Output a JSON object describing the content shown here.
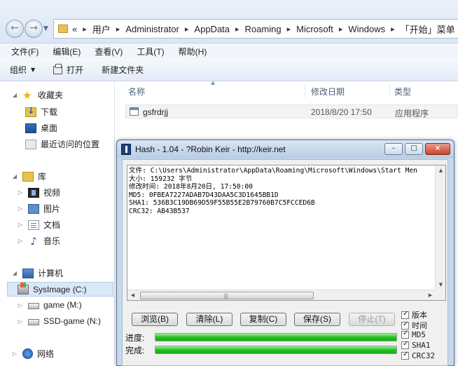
{
  "explorer": {
    "address": {
      "overflow_marker": "«",
      "crumbs": [
        "用户",
        "Administrator",
        "AppData",
        "Roaming",
        "Microsoft",
        "Windows",
        "「开始」菜单"
      ]
    },
    "menu": [
      "文件(F)",
      "编辑(E)",
      "查看(V)",
      "工具(T)",
      "帮助(H)"
    ],
    "toolbar": {
      "organize": "组织",
      "open": "打开",
      "new_folder": "新建文件夹"
    },
    "sidebar": {
      "favorites": "收藏夹",
      "downloads": "下载",
      "desktop": "桌面",
      "recent": "最近访问的位置",
      "libraries": "库",
      "videos": "视频",
      "pictures": "图片",
      "documents": "文档",
      "music": "音乐",
      "computer": "计算机",
      "drive_c": "SysImage (C:)",
      "drive_m": "game (M:)",
      "drive_n": "SSD-game (N:)",
      "network": "网络"
    },
    "columns": {
      "name": "名称",
      "date": "修改日期",
      "type": "类型"
    },
    "file": {
      "name": "gsfrdrjj",
      "date": "2018/8/20 17:50",
      "type": "应用程序"
    }
  },
  "hash_window": {
    "title": "Hash - 1.04 - ?Robin Keir - http://keir.net",
    "buttons": {
      "minimize": "–",
      "maximize": "□",
      "close": "×"
    },
    "output_lines": {
      "file": "文件: C:\\Users\\Administrator\\AppData\\Roaming\\Microsoft\\Windows\\Start Men",
      "size": "大小: 159232 字节",
      "modified": "修改时间: 2018年8月20日, 17:50:00",
      "md5": "MD5: 0FBEA7227ADAB7D43DAA5C3D1645BB1D",
      "sha1": "SHA1: 536B3C19DB69D59F55B55E2B79760B7C5FCCED6B",
      "crc32": "CRC32: AB43B537"
    },
    "actions": {
      "browse": "浏览(B)",
      "clear": "清除(L)",
      "copy": "复制(C)",
      "save": "保存(S)",
      "stop": "停止(T)"
    },
    "progress_label": "进度:",
    "complete_label": "完成:",
    "progress_fraction": 1.0,
    "complete_fraction": 1.0,
    "options": {
      "version": "版本",
      "time": "时间",
      "md5": "MD5",
      "sha1": "SHA1",
      "crc32": "CRC32"
    }
  }
}
